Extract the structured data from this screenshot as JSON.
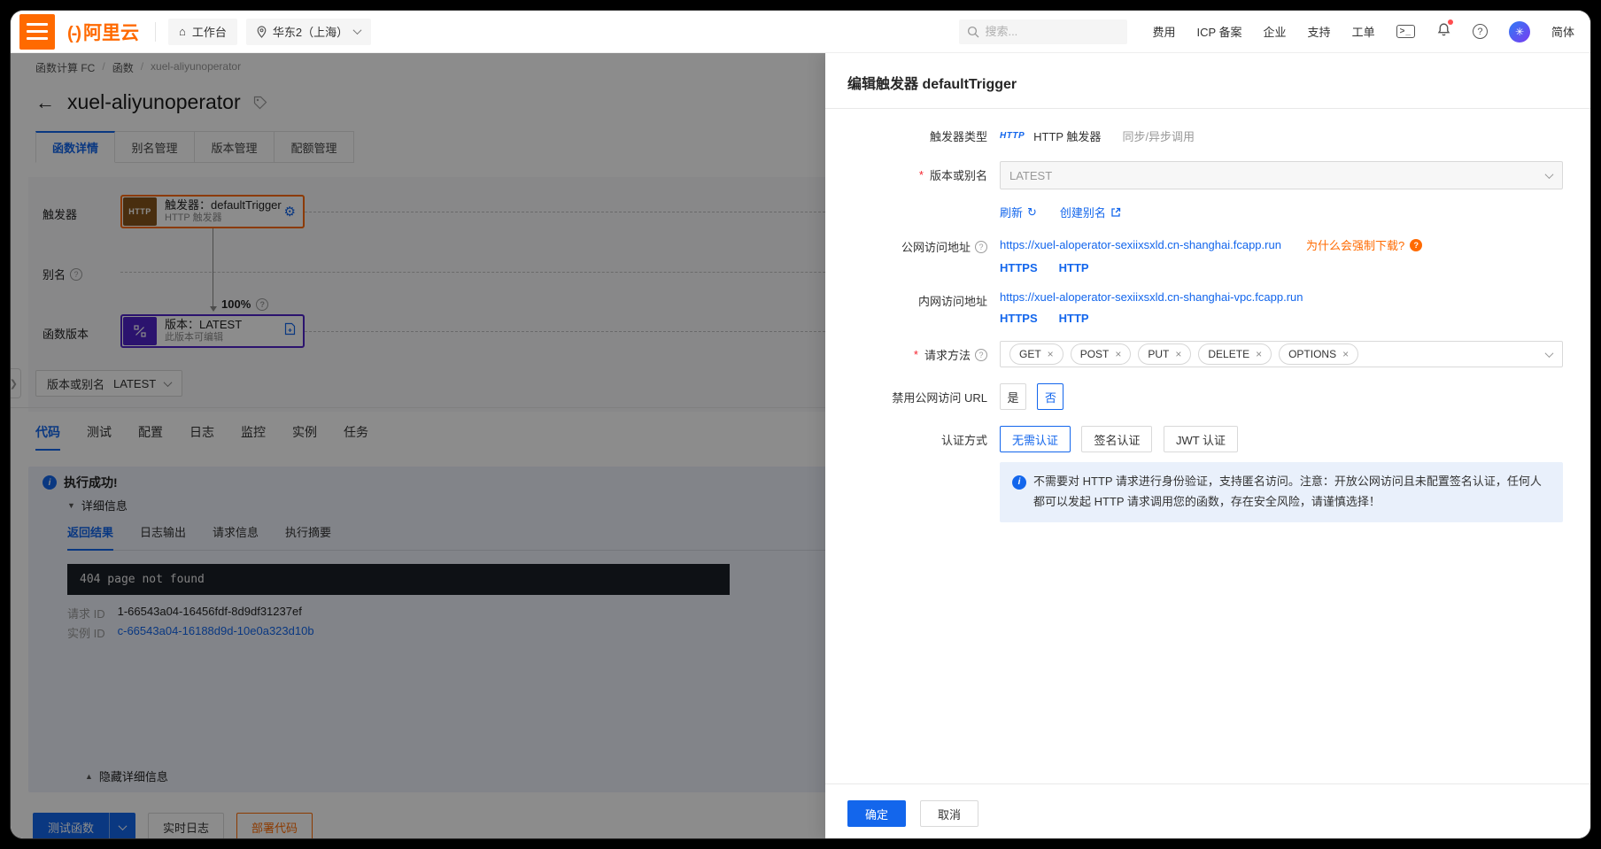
{
  "navbar": {
    "brand": "阿里云",
    "workbench": "工作台",
    "region": "华东2（上海）",
    "search_placeholder": "搜索...",
    "links": [
      "费用",
      "ICP 备案",
      "企业",
      "支持",
      "工单"
    ],
    "terminal_glyph": ">_",
    "lang": "简体"
  },
  "breadcrumb": [
    "函数计算 FC",
    "函数",
    "xuel-aliyunoperator"
  ],
  "page_title": "xuel-aliyunoperator",
  "main_tabs": [
    "函数详情",
    "别名管理",
    "版本管理",
    "配额管理"
  ],
  "diagram": {
    "trigger_row_label": "触发器",
    "trigger_icon_text": "HTTP",
    "trigger_card_title": "触发器：defaultTrigger",
    "trigger_card_subtitle": "HTTP 触发器",
    "alias_row_label": "别名",
    "weight_label": "100%",
    "version_row_label": "函数版本",
    "version_card_title": "版本：LATEST",
    "version_card_subtitle": "此版本可编辑"
  },
  "version_selector": {
    "label": "版本或别名",
    "value": "LATEST"
  },
  "code_tabs": [
    "代码",
    "测试",
    "配置",
    "日志",
    "监控",
    "实例",
    "任务"
  ],
  "result": {
    "status_text": "执行成功!",
    "detail_toggle": "详细信息",
    "tabs": [
      "返回结果",
      "日志输出",
      "请求信息",
      "执行摘要"
    ],
    "console_text": "404 page not found",
    "request_id_label": "请求 ID",
    "request_id_value": "1-66543a04-16456fdf-8d9df31237ef",
    "instance_id_label": "实例 ID",
    "instance_id_value": "c-66543a04-16188d9d-10e0a323d10b",
    "hide_detail_label": "隐藏详细信息"
  },
  "footer_actions": {
    "test": "测试函数",
    "live_log": "实时日志",
    "deploy": "部署代码"
  },
  "drawer": {
    "title": "编辑触发器 defaultTrigger",
    "trigger_type": {
      "label": "触发器类型",
      "badge": "HTTP",
      "value": "HTTP 触发器",
      "mode": "同步/异步调用"
    },
    "version_alias": {
      "label": "版本或别名",
      "value": "LATEST"
    },
    "refresh_link": "刷新",
    "create_alias_link": "创建别名",
    "public_url": {
      "label": "公网访问地址",
      "url": "https://xuel-aloperator-sexiixsxld.cn-shanghai.fcapp.run",
      "warning_link": "为什么会强制下载?",
      "https": "HTTPS",
      "http": "HTTP"
    },
    "private_url": {
      "label": "内网访问地址",
      "url": "https://xuel-aloperator-sexiixsxld.cn-shanghai-vpc.fcapp.run",
      "https": "HTTPS",
      "http": "HTTP"
    },
    "methods": {
      "label": "请求方法",
      "tags": [
        "GET",
        "POST",
        "PUT",
        "DELETE",
        "OPTIONS"
      ]
    },
    "disable_internet_url": {
      "label": "禁用公网访问 URL",
      "yes": "是",
      "no": "否",
      "selected": "否"
    },
    "auth": {
      "label": "认证方式",
      "options": [
        "无需认证",
        "签名认证",
        "JWT 认证"
      ],
      "selected": "无需认证"
    },
    "info_text": "不需要对 HTTP 请求进行身份验证，支持匿名访问。注意：开放公网访问且未配置签名认证，任何人都可以发起 HTTP 请求调用您的函数，存在安全风险，请谨慎选择！",
    "ok": "确定",
    "cancel": "取消"
  },
  "icons": {
    "logo_mark": "(-)",
    "home": "⌂",
    "back_arrow": "←",
    "gear": "⚙",
    "refresh": "↻",
    "close": "×",
    "caret_down": "▼",
    "caret_up": "▲",
    "question": "?",
    "info": "i",
    "avatar_star": "✳"
  },
  "colors": {
    "brand_orange": "#FF6A00",
    "primary_blue": "#1366EC",
    "version_purple": "#4F23C8",
    "mask": "rgba(0,0,0,0.45)"
  }
}
